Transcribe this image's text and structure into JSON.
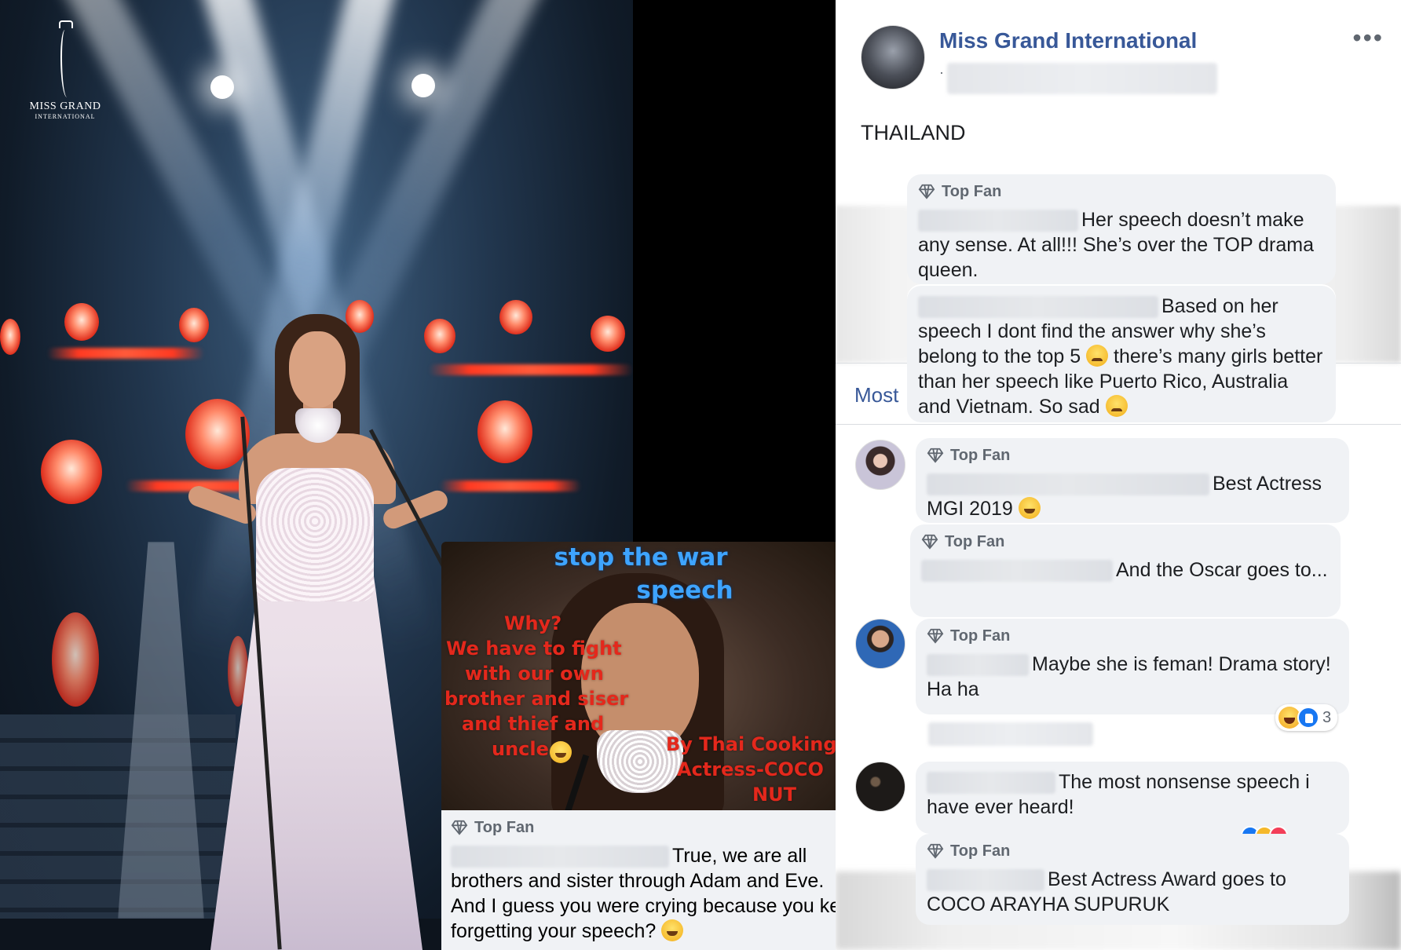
{
  "logo": {
    "brand": "MISS GRAND",
    "sub": "INTERNATIONAL",
    "mark": "MGI"
  },
  "meme": {
    "title1": "stop the war",
    "title2": "speech",
    "line1": "Why?",
    "line2": "We have to fight",
    "line3": "with our own",
    "line4": "brother and siser",
    "line5": "and thief and",
    "line6": "uncle",
    "credit1": "By Thai Cooking",
    "credit2": "Actress-COCO",
    "credit3": "NUT"
  },
  "post": {
    "page_name": "Miss Grand International",
    "dot": "·",
    "text": "THAILAND",
    "more_icon": "more-options-icon",
    "sort_label": "Most"
  },
  "comments": {
    "badge": "Top Fan",
    "c1": "Her speech doesn’t make any sense. At all!!! She’s over the TOP drama queen.",
    "c2": "Based on her speech I dont find the answer why she’s belong to the top 5",
    "c2b": "there’s many girls better than her speech like Puerto Rico, Australia and Vietnam. So sad",
    "c3": "Best Actress MGI 2019",
    "c4": "And the Oscar goes to...",
    "c5": "Maybe she is feman! Drama story! Ha ha",
    "c5_reactions": "3",
    "c6": "The most nonsense speech i have ever heard!",
    "c7": "Best Actress Award goes to COCO ARAYHA SUPURUK",
    "c8": "True, we are all brothers and sister through Adam and Eve. And I guess you were crying because you kept forgetting your speech?"
  },
  "colors": {
    "link_blue": "#385898",
    "bubble_bg": "#f0f2f5",
    "meme_blue": "#3ea4ff",
    "meme_red": "#e4281c",
    "like_blue": "#1877f2"
  }
}
